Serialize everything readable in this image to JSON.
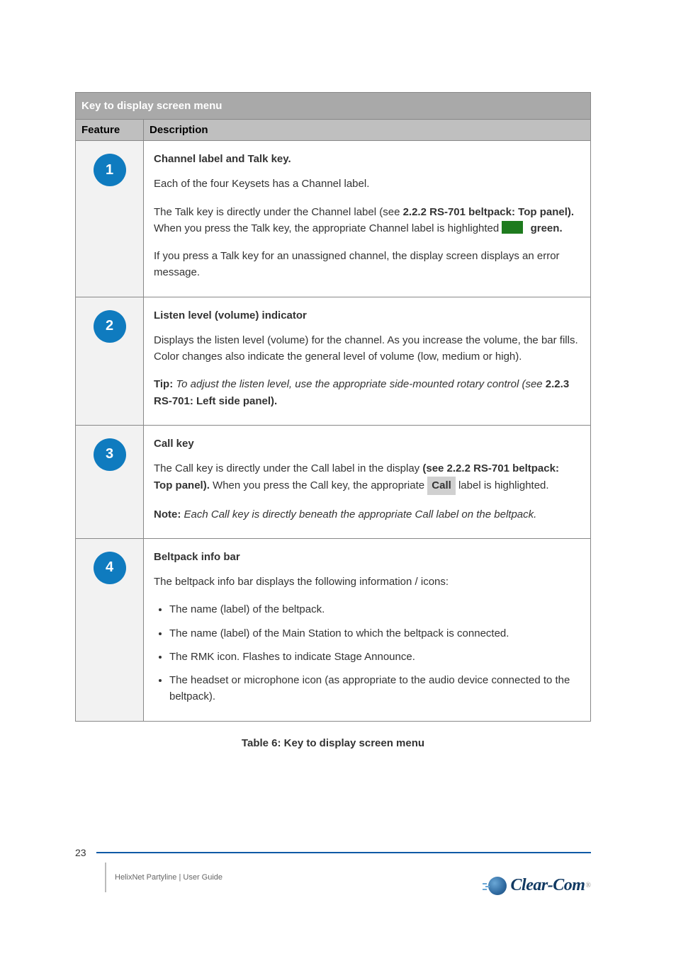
{
  "table": {
    "title": "Key to display screen menu",
    "col1": "Feature",
    "col2": "Description",
    "rows": [
      {
        "num": "1",
        "title": "Channel label and Talk key.",
        "body": [
          "Each of the four Keysets has a Channel label.",
          "The Talk key is directly under the Channel label (see <b>2.2.2 RS-701 beltpack: Top panel).</b> When you press the Talk key, the appropriate Channel label is highlighted <span class='green-sq'></span> <b>green.</b>",
          "If you press a Talk key for an unassigned channel, the display screen displays an error message."
        ]
      },
      {
        "num": "2",
        "title": "Listen level (volume) indicator",
        "body": [
          "Displays the listen level (volume) for the channel. As you increase the volume, the bar fills. Color changes also indicate the general level of volume (low, medium or high).",
          "<b>Tip:</b> <i>To adjust the listen level, use the appropriate side-mounted rotary control (see </i><b>2.2.3 RS-701: Left side panel).</b>"
        ]
      },
      {
        "num": "3",
        "title": "Call key",
        "body": [
          "The Call key is directly under the Call label in the display <b>(see 2.2.2 RS-701 beltpack: Top panel).</b> When you press the Call key, the appropriate <span class='grey-pill'>Call</span> label is highlighted.",
          "<b>Note:</b> <i>Each Call key is directly beneath the appropriate Call label on the beltpack.</i>"
        ]
      },
      {
        "num": "4",
        "title": "Beltpack info bar",
        "body": [
          "The beltpack info bar displays the following information / icons:",
          "<ul style='margin:0 0 0 22px;'><li style='margin-bottom:10px;'>The name (label) of the beltpack.</li><li style='margin-bottom:10px;'>The name (label) of the Main Station to which the beltpack is connected.</li><li style='margin-bottom:10px;'>The RMK icon. Flashes to indicate Stage Announce.</li><li>The headset or microphone icon (as appropriate to the audio device connected to the beltpack).</li></ul>"
        ]
      }
    ]
  },
  "caption": "Table 6: Key to display screen menu",
  "footer": {
    "page": "23",
    "doc": "HelixNet Partyline | User Guide"
  },
  "logo_text": "Clear-Com"
}
